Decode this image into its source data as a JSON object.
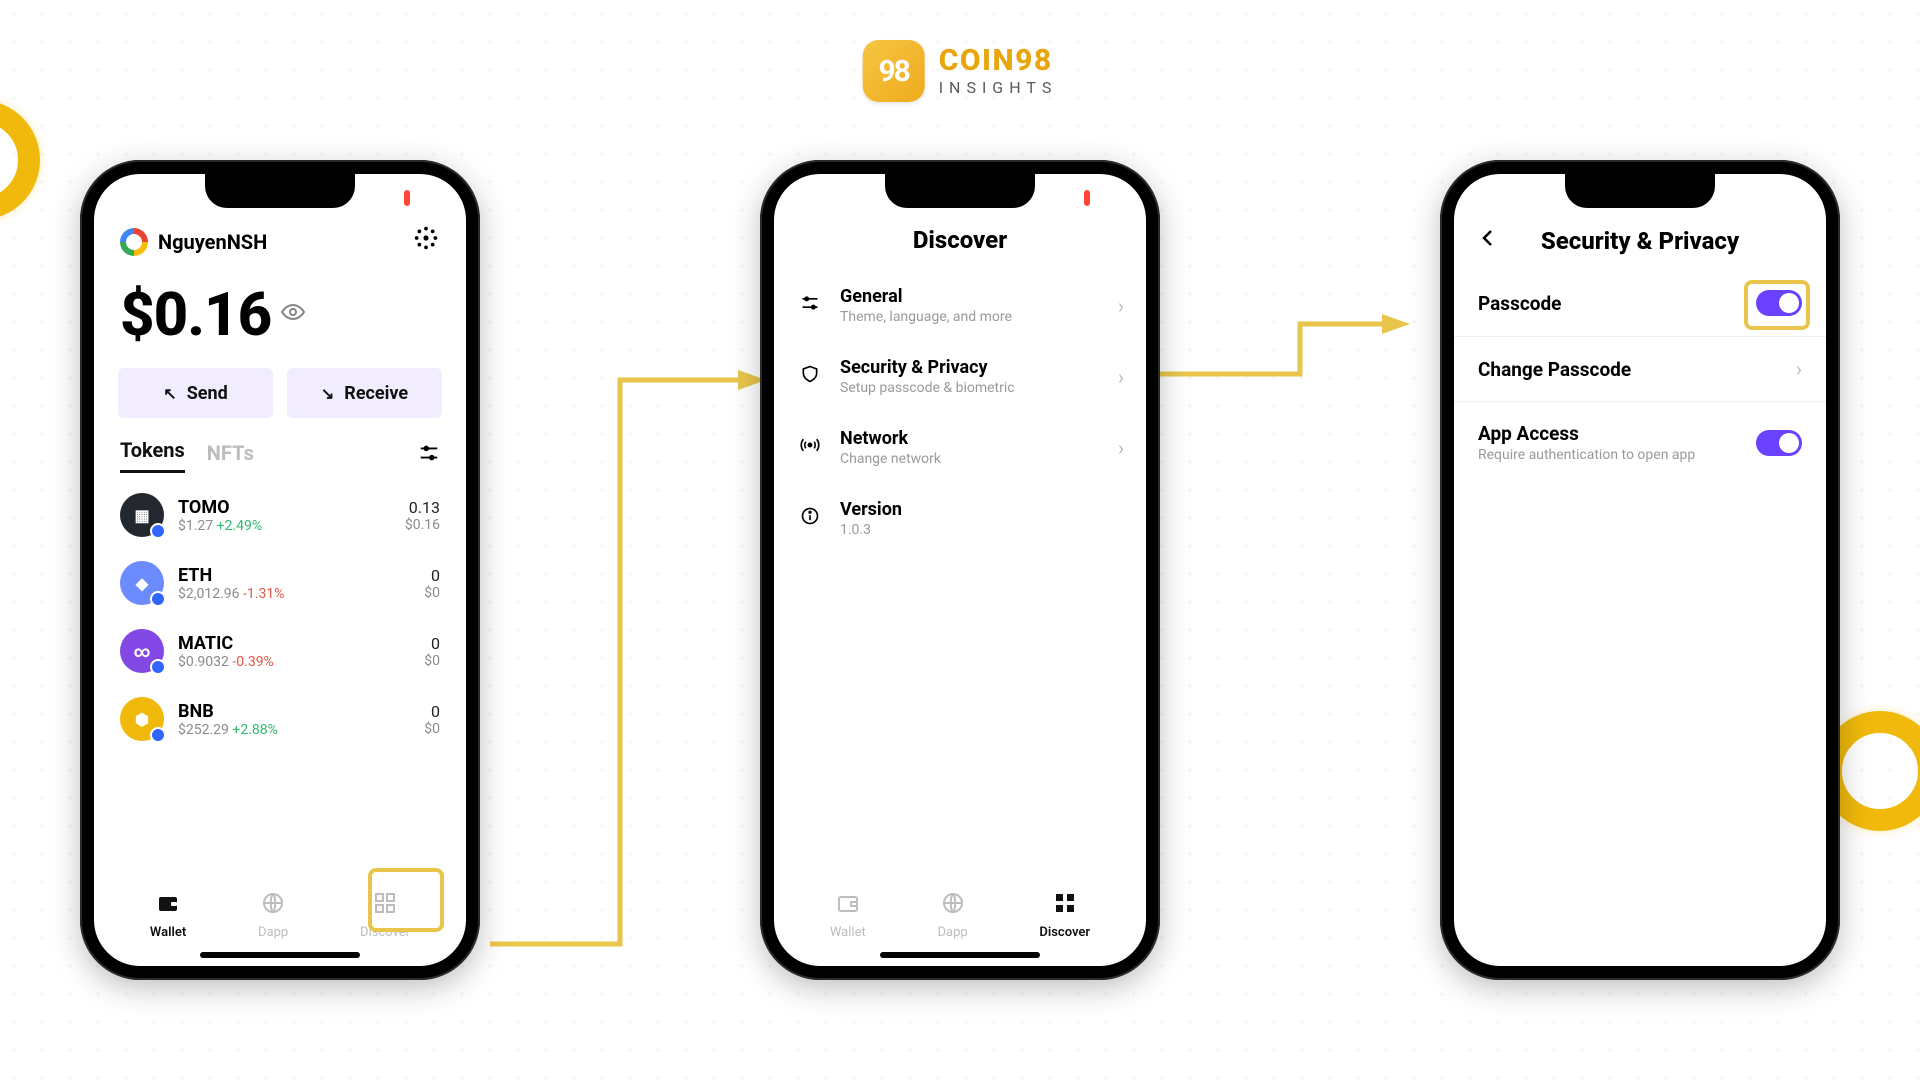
{
  "brand": {
    "name": "COIN98",
    "sub": "INSIGHTS",
    "logo_glyph": "98"
  },
  "screen1": {
    "account": "NguyenNSH",
    "balance": "$0.16",
    "send": "Send",
    "receive": "Receive",
    "tab_tokens": "Tokens",
    "tab_nfts": "NFTs",
    "tokens": [
      {
        "sym": "TOMO",
        "price": "$1.27",
        "chg": "+2.49%",
        "dir": "pos",
        "qty": "0.13",
        "usd": "$0.16",
        "bg": "#23282f"
      },
      {
        "sym": "ETH",
        "price": "$2,012.96",
        "chg": "-1.31%",
        "dir": "neg",
        "qty": "0",
        "usd": "$0",
        "bg": "#6b8bff"
      },
      {
        "sym": "MATIC",
        "price": "$0.9032",
        "chg": "-0.39%",
        "dir": "neg",
        "qty": "0",
        "usd": "$0",
        "bg": "#8247e5"
      },
      {
        "sym": "BNB",
        "price": "$252.29",
        "chg": "+2.88%",
        "dir": "pos",
        "qty": "0",
        "usd": "$0",
        "bg": "#f0b90b"
      }
    ],
    "nav": {
      "wallet": "Wallet",
      "dapp": "Dapp",
      "discover": "Discover"
    }
  },
  "screen2": {
    "title": "Discover",
    "items": [
      {
        "title": "General",
        "sub": "Theme, language, and more",
        "icon": "sliders",
        "arrow": true
      },
      {
        "title": "Security & Privacy",
        "sub": "Setup passcode & biometric",
        "icon": "shield",
        "arrow": true
      },
      {
        "title": "Network",
        "sub": "Change network",
        "icon": "broadcast",
        "arrow": true
      },
      {
        "title": "Version",
        "sub": "1.0.3",
        "icon": "info",
        "arrow": false
      }
    ],
    "nav": {
      "wallet": "Wallet",
      "dapp": "Dapp",
      "discover": "Discover"
    }
  },
  "screen3": {
    "title": "Security & Privacy",
    "rows": {
      "passcode": "Passcode",
      "change": "Change Passcode",
      "access": "App Access",
      "access_sub": "Require authentication to open app"
    }
  }
}
